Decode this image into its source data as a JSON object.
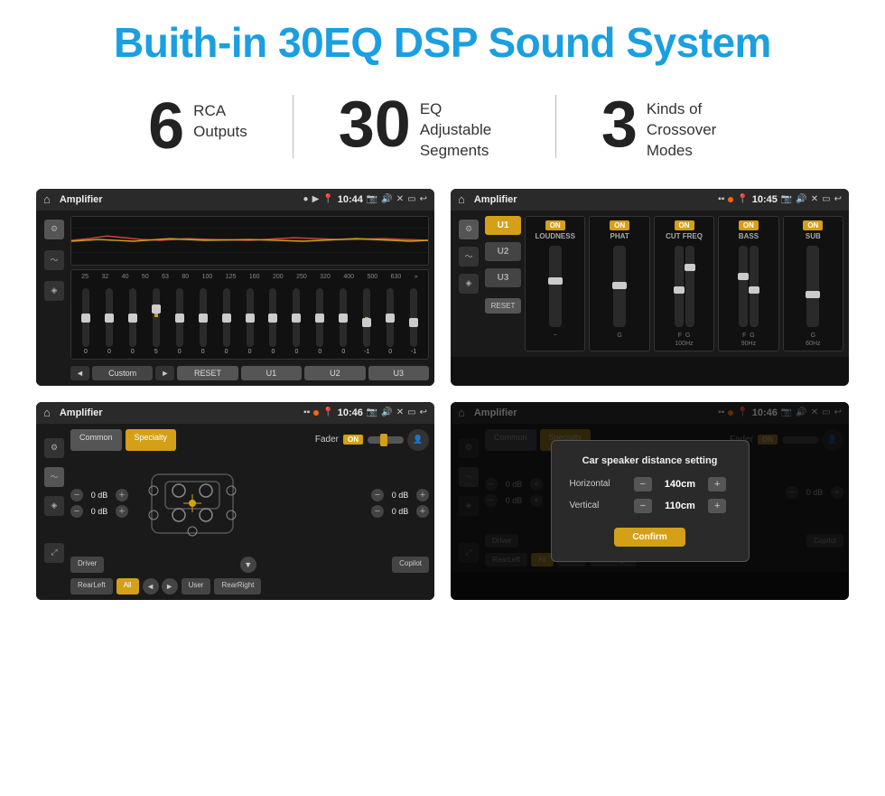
{
  "header": {
    "title": "Buith-in 30EQ DSP Sound System"
  },
  "stats": [
    {
      "number": "6",
      "label": "RCA\nOutputs"
    },
    {
      "number": "30",
      "label": "EQ Adjustable\nSegments"
    },
    {
      "number": "3",
      "label": "Kinds of\nCrossover Modes"
    }
  ],
  "screens": [
    {
      "id": "eq-screen",
      "statusBar": {
        "title": "Amplifier",
        "time": "10:44",
        "indicators": [
          "dot",
          "play"
        ]
      },
      "bottomBar": [
        "◄",
        "Custom",
        "►",
        "RESET",
        "U1",
        "U2",
        "U3"
      ],
      "freqLabels": [
        "25",
        "32",
        "40",
        "50",
        "63",
        "80",
        "100",
        "125",
        "160",
        "200",
        "250",
        "320",
        "400",
        "500",
        "630"
      ],
      "sliderValues": [
        "0",
        "0",
        "0",
        "5",
        "0",
        "0",
        "0",
        "0",
        "0",
        "0",
        "0",
        "0",
        "-1",
        "0",
        "-1"
      ]
    },
    {
      "id": "crossover-screen",
      "statusBar": {
        "title": "Amplifier",
        "time": "10:45",
        "indicators": [
          "squares",
          "dot"
        ]
      },
      "uButtons": [
        "U1",
        "U2",
        "U3"
      ],
      "channels": [
        {
          "label": "LOUDNESS",
          "on": true
        },
        {
          "label": "PHAT",
          "on": true
        },
        {
          "label": "CUT FREQ",
          "on": true
        },
        {
          "label": "BASS",
          "on": true
        },
        {
          "label": "SUB",
          "on": true
        }
      ],
      "resetLabel": "RESET"
    },
    {
      "id": "balance-screen",
      "statusBar": {
        "title": "Amplifier",
        "time": "10:46",
        "indicators": [
          "squares",
          "dot"
        ]
      },
      "tabs": [
        "Common",
        "Specialty"
      ],
      "faderLabel": "Fader",
      "faderOn": true,
      "volRows": [
        {
          "val": "0 dB"
        },
        {
          "val": "0 dB"
        },
        {
          "val": "0 dB"
        },
        {
          "val": "0 dB"
        }
      ],
      "bottomButtons": [
        "Driver",
        "RearLeft",
        "All",
        "User",
        "Copilot",
        "RearRight"
      ]
    },
    {
      "id": "distance-screen",
      "statusBar": {
        "title": "Amplifier",
        "time": "10:46",
        "indicators": [
          "squares",
          "dot"
        ]
      },
      "tabs": [
        "Common",
        "Specialty"
      ],
      "dialog": {
        "title": "Car speaker distance setting",
        "rows": [
          {
            "label": "Horizontal",
            "value": "140cm"
          },
          {
            "label": "Vertical",
            "value": "110cm"
          }
        ],
        "confirmLabel": "Confirm"
      },
      "volRows": [
        {
          "val": "0 dB"
        },
        {
          "val": "0 dB"
        }
      ],
      "bottomButtons": [
        "Driver",
        "RearLeft...",
        "All",
        "User",
        "RearRight"
      ]
    }
  ],
  "colors": {
    "accent": "#1a9fe0",
    "titleBlue": "#1a9fe0",
    "gold": "#d4a017",
    "darkBg": "#1a1a1a",
    "statusBg": "#2a2a2a"
  }
}
